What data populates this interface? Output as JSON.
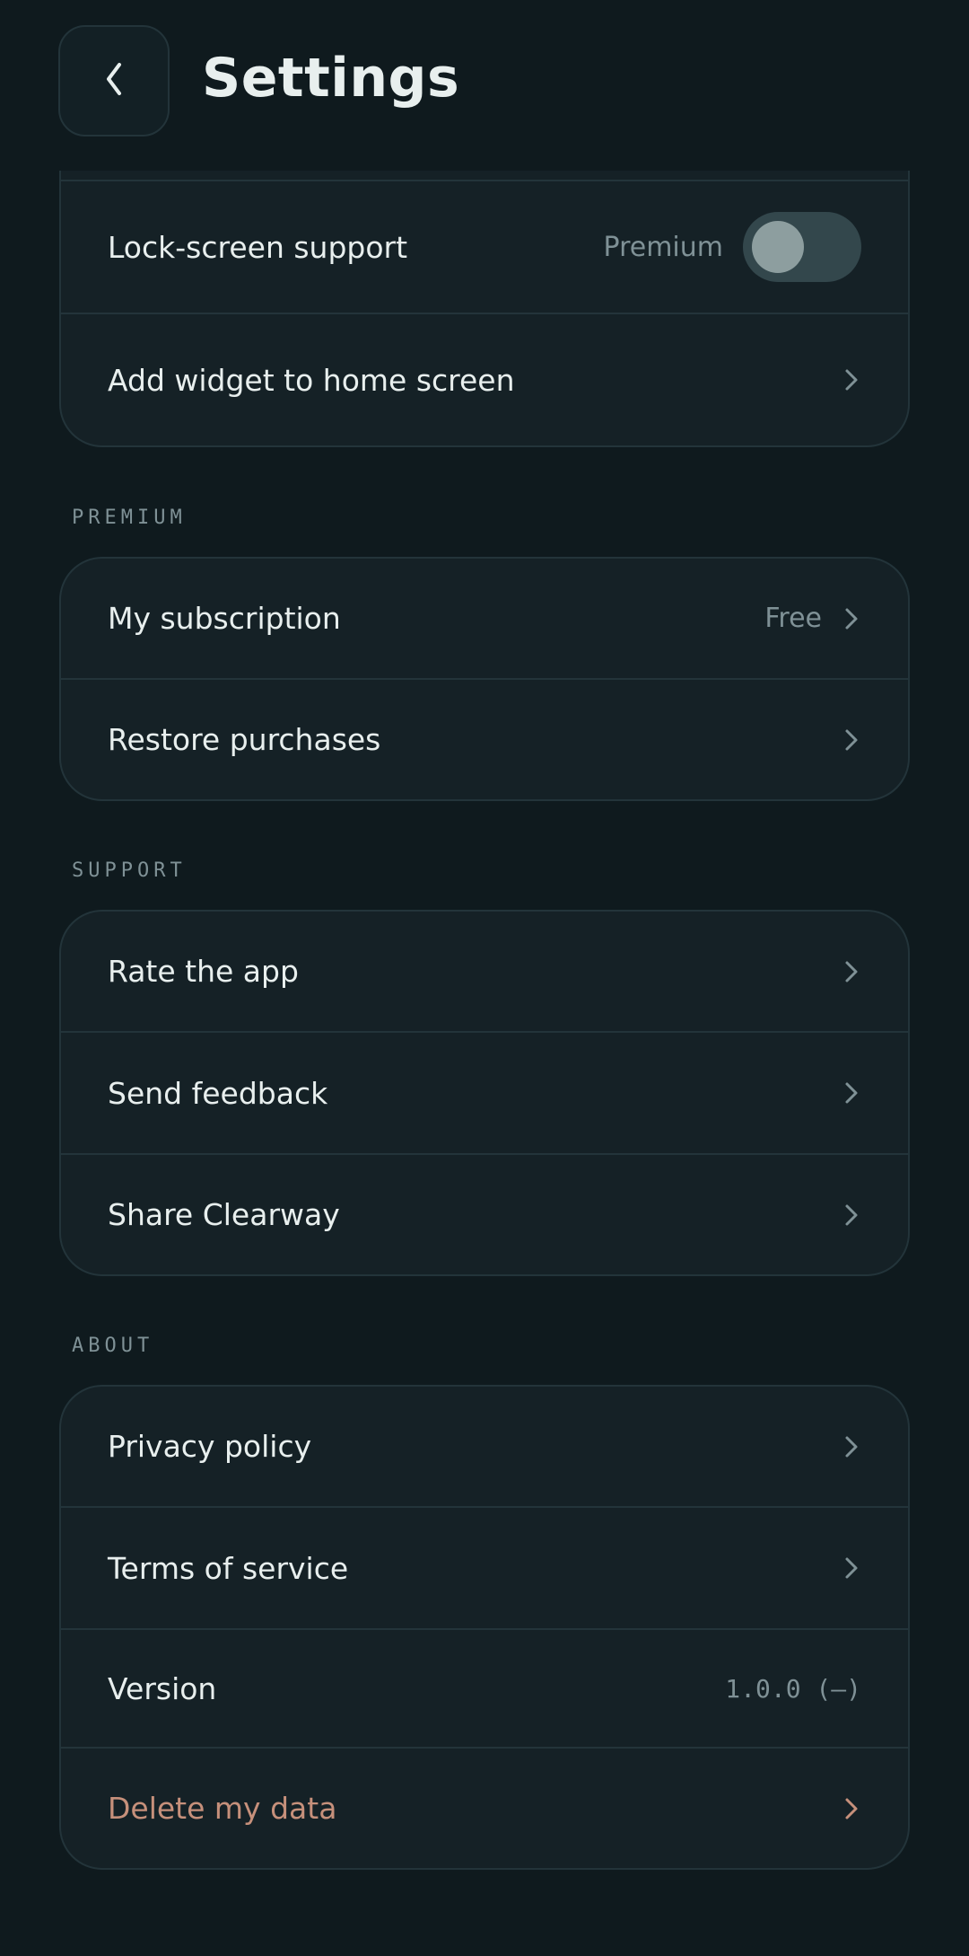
{
  "header": {
    "title": "Settings",
    "back_icon": "chevron-left-icon"
  },
  "top_group": {
    "items": [
      {
        "label": "Lock-screen support",
        "badge": "Premium",
        "toggle_on": false
      },
      {
        "label": "Add widget to home screen"
      }
    ]
  },
  "premium": {
    "heading": "PREMIUM",
    "items": [
      {
        "label": "My subscription",
        "value": "Free"
      },
      {
        "label": "Restore purchases"
      }
    ]
  },
  "support": {
    "heading": "SUPPORT",
    "items": [
      {
        "label": "Rate the app"
      },
      {
        "label": "Send feedback"
      },
      {
        "label": "Share Clearway"
      }
    ]
  },
  "about": {
    "heading": "ABOUT",
    "items": [
      {
        "label": "Privacy policy"
      },
      {
        "label": "Terms of service"
      },
      {
        "label": "Version",
        "value": "1.0.0 (—)"
      },
      {
        "label": "Delete my data"
      }
    ]
  },
  "colors": {
    "background": "#0f1a1e",
    "card": "#152126",
    "muted_text": "#7f9196",
    "danger_text": "#c6907b"
  }
}
